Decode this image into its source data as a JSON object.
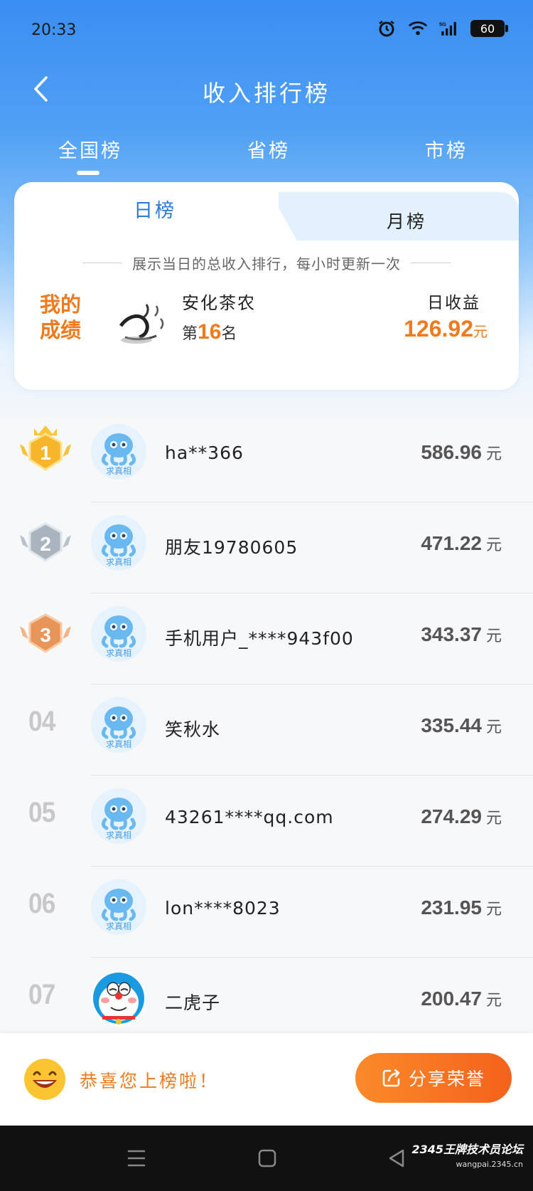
{
  "status_bar": {
    "time": "20:33",
    "battery": "60",
    "network": "5G"
  },
  "nav": {
    "title": "收入排行榜"
  },
  "scope_tabs": [
    "全国榜",
    "省榜",
    "市榜"
  ],
  "period_tabs": {
    "day": "日榜",
    "month": "月榜"
  },
  "description": "展示当日的总收入排行，每小时更新一次",
  "my_score": {
    "label_line1": "我的",
    "label_line2": "成绩",
    "name": "安化茶农",
    "rank_prefix": "第",
    "rank": "16",
    "rank_suffix": "名",
    "income_label": "日收益",
    "income": "126.92",
    "currency": "元"
  },
  "avatar_tag": "求真相",
  "rankings": [
    {
      "rank": "1",
      "name": "ha**366",
      "amount": "586.96"
    },
    {
      "rank": "2",
      "name": "朋友19780605",
      "amount": "471.22"
    },
    {
      "rank": "3",
      "name": "手机用户_****943f00",
      "amount": "343.37"
    },
    {
      "rank": "04",
      "name": "笑秋水",
      "amount": "335.44"
    },
    {
      "rank": "05",
      "name": "43261****qq.com",
      "amount": "274.29"
    },
    {
      "rank": "06",
      "name": "lon****8023",
      "amount": "231.95"
    },
    {
      "rank": "07",
      "name": "二虎子",
      "amount": "200.47"
    }
  ],
  "currency": "元",
  "bottom": {
    "congrats": "恭喜您上榜啦！",
    "share": "分享荣誉"
  },
  "watermark": {
    "brand": "2345王牌技术员论坛",
    "url": "wangpai.2345.cn"
  },
  "colors": {
    "accent_orange": "#f07a1c",
    "primary_blue": "#3b8ef2"
  }
}
